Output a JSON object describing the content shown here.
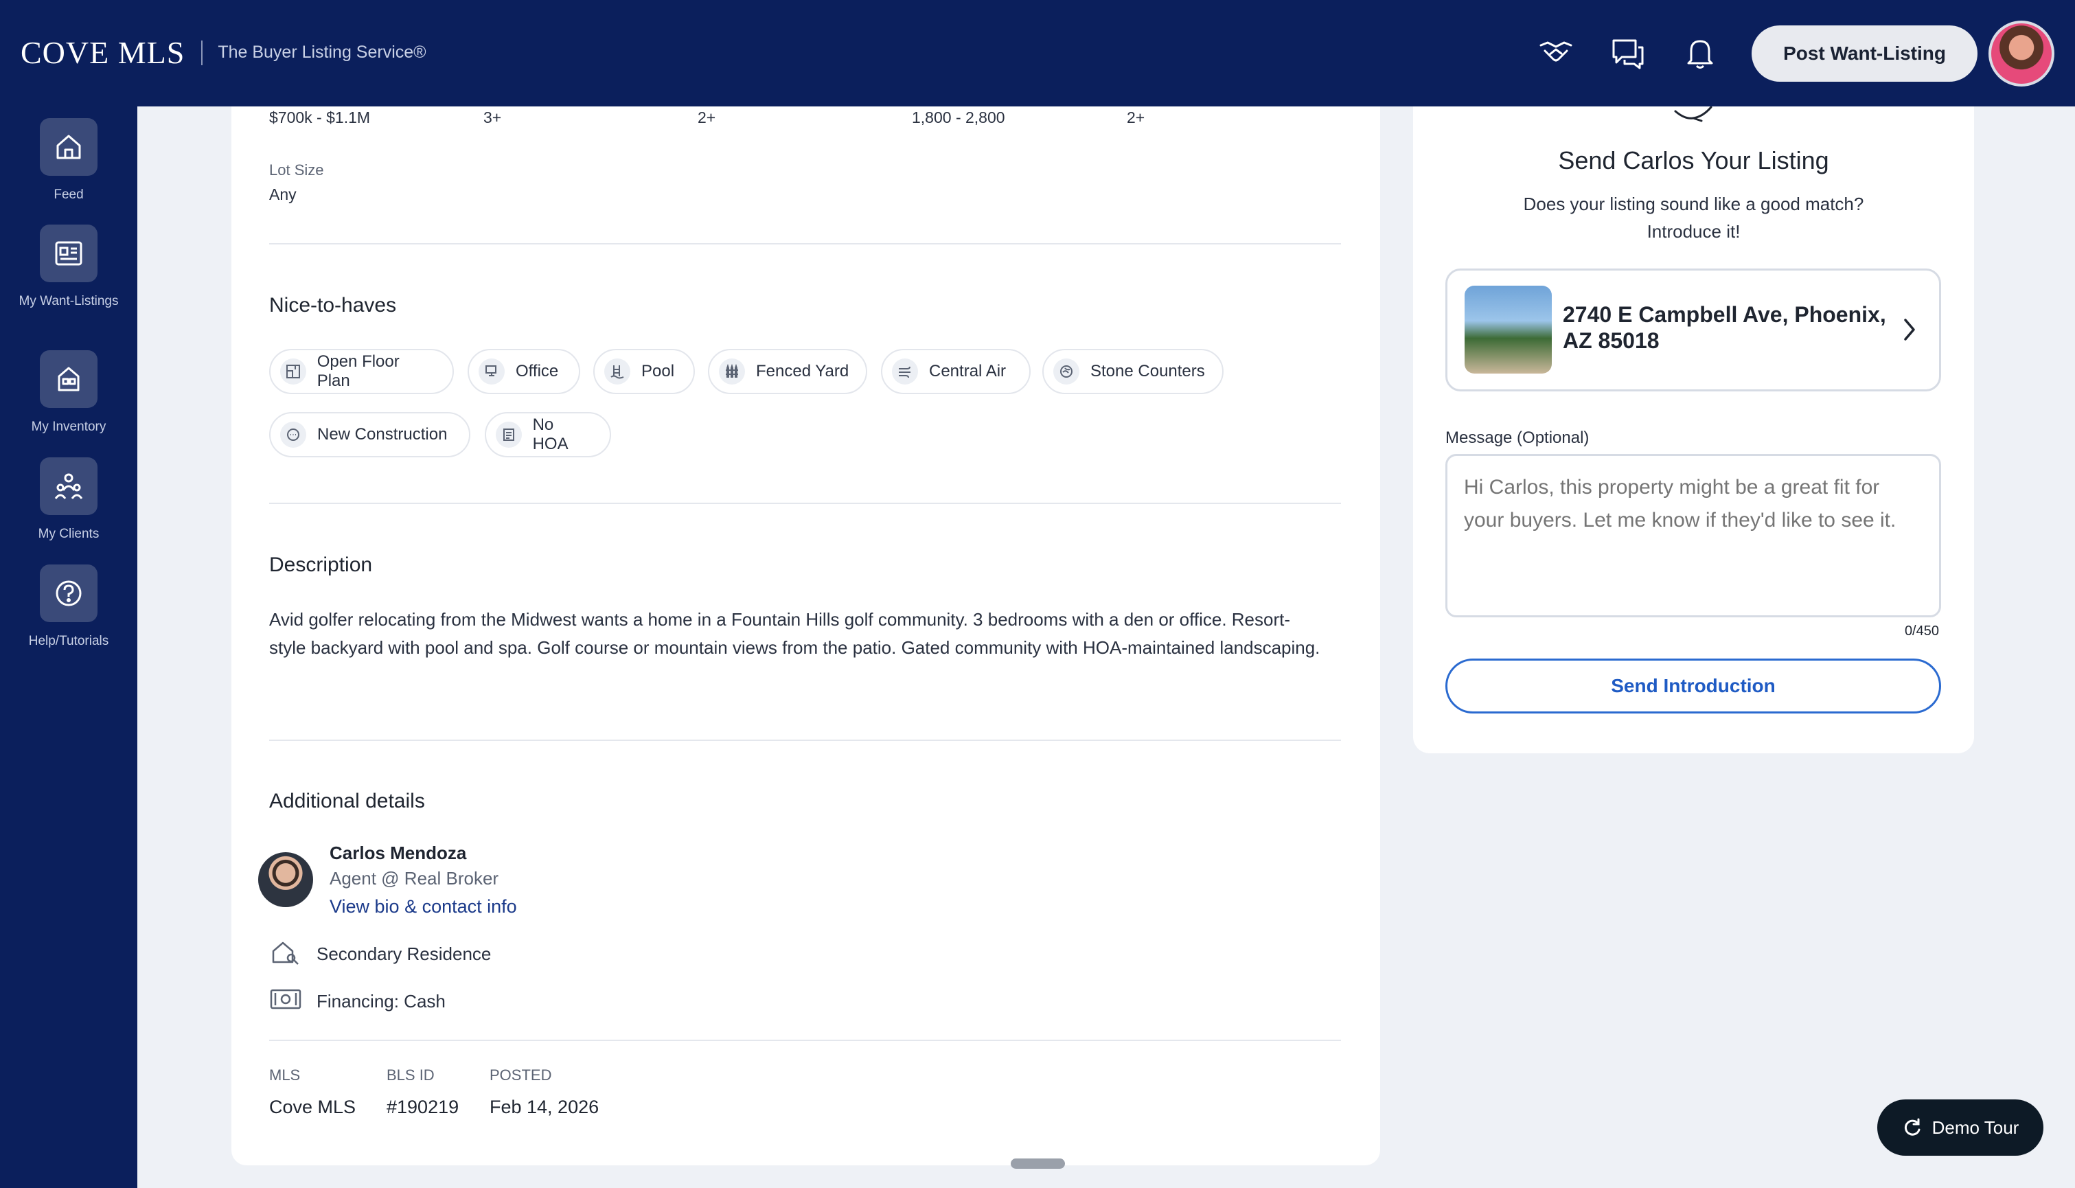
{
  "header": {
    "logo": "COVE MLS",
    "tagline": "The Buyer Listing Service®",
    "post_button": "Post Want-Listing"
  },
  "sidebar": {
    "items": [
      {
        "label": "Feed"
      },
      {
        "label": "My Want-Listings"
      },
      {
        "label": "My Inventory"
      },
      {
        "label": "My Clients"
      },
      {
        "label": "Help/Tutorials"
      }
    ]
  },
  "criteria": {
    "values": [
      "$700k - $1.1M",
      "3+",
      "2+",
      "1,800 - 2,800",
      "2+"
    ],
    "lot_size_label": "Lot Size",
    "lot_size_value": "Any"
  },
  "nice_to_haves": {
    "title": "Nice-to-haves",
    "chips": [
      "Open Floor Plan",
      "Office",
      "Pool",
      "Fenced Yard",
      "Central Air",
      "Stone Counters",
      "New Construction",
      "No HOA"
    ]
  },
  "description": {
    "title": "Description",
    "text": "Avid golfer relocating from the Midwest wants a home in a Fountain Hills golf community. 3 bedrooms with a den or office. Resort-style backyard with pool and spa. Golf course or mountain views from the patio. Gated community with HOA-maintained landscaping."
  },
  "additional": {
    "title": "Additional details",
    "agent_name": "Carlos Mendoza",
    "agent_role": "Agent @ Real Broker",
    "agent_link": "View bio & contact info",
    "residence": "Secondary Residence",
    "financing": "Financing: Cash",
    "meta": [
      {
        "label": "MLS",
        "value": "Cove MLS"
      },
      {
        "label": "BLS ID",
        "value": "#190219"
      },
      {
        "label": "POSTED",
        "value": "Feb 14, 2026"
      }
    ]
  },
  "send_panel": {
    "title": "Send Carlos Your Listing",
    "subtitle_line1": "Does your listing sound like a good match?",
    "subtitle_line2": "Introduce it!",
    "listing_address_line1": "2740 E Campbell Ave, Phoenix,",
    "listing_address_line2": "AZ 85018",
    "message_label": "Message (Optional)",
    "message_placeholder": "Hi Carlos, this property might be a great fit for your buyers. Let me know if they'd like to see it.",
    "char_count": "0/450",
    "send_button": "Send Introduction"
  },
  "demo_tour": "Demo Tour",
  "colors": {
    "navy": "#0b1f5c",
    "accent_blue": "#1f5bc4",
    "link": "#1b3a8a"
  }
}
